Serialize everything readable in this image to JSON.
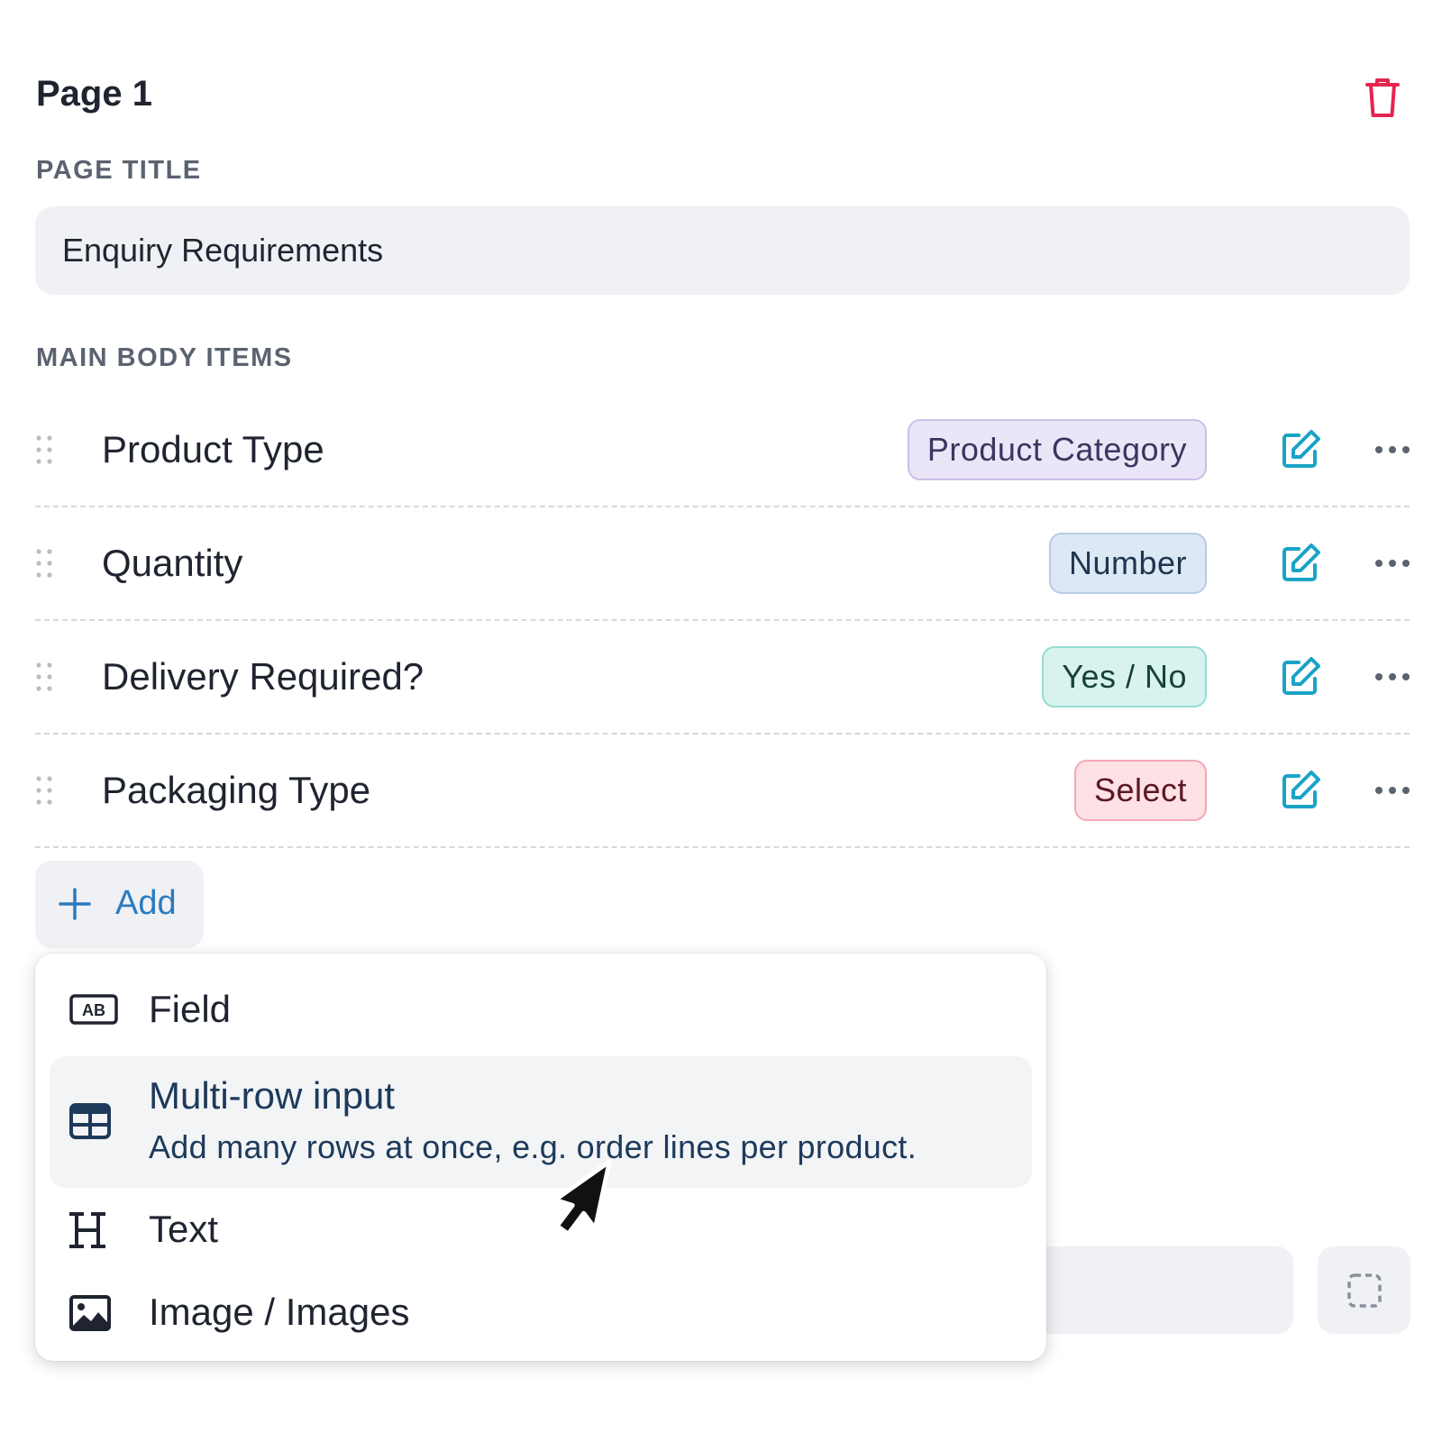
{
  "page": {
    "heading": "Page 1",
    "delete_icon": "trash-icon",
    "page_title_label": "PAGE TITLE",
    "page_title_value": "Enquiry Requirements",
    "body_items_label": "MAIN BODY ITEMS"
  },
  "items": [
    {
      "label": "Product Type",
      "type": "Product Category"
    },
    {
      "label": "Quantity",
      "type": "Number"
    },
    {
      "label": "Delivery Required?",
      "type": "Yes / No"
    },
    {
      "label": "Packaging Type",
      "type": "Select"
    }
  ],
  "badge_colors": {
    "product_category": {
      "bg": "#ebe6f7",
      "border": "#cbbfe9",
      "text": "#3c3560"
    },
    "number": {
      "bg": "#dde8f5",
      "border": "#b7cce6",
      "text": "#1f3550"
    },
    "yes_no": {
      "bg": "#d8f3ef",
      "border": "#94ddd1",
      "text": "#17413b"
    },
    "select": {
      "bg": "#fde1e5",
      "border": "#f3a8b5",
      "text": "#5c1724"
    }
  },
  "add_button": {
    "label": "Add",
    "icon": "plus-icon"
  },
  "dropdown": {
    "items": [
      {
        "label": "Field",
        "icon": "text-field-icon"
      },
      {
        "label": "Multi-row input",
        "description": "Add many rows at once, e.g. order lines per product.",
        "icon": "table-icon"
      },
      {
        "label": "Text",
        "icon": "heading-icon"
      },
      {
        "label": "Image / Images",
        "icon": "image-icon"
      }
    ]
  },
  "colors": {
    "accent_blue": "#2b7bbf",
    "edit_icon": "#1aa3c6",
    "delete_red": "#e5254f"
  }
}
